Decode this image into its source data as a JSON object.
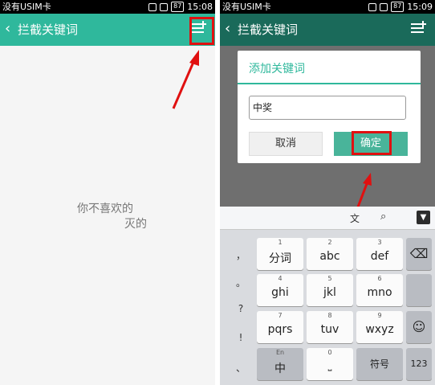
{
  "screen1": {
    "status": {
      "carrier": "没有USIM卡",
      "time": "15:08",
      "battery": "87"
    },
    "title": "拦截关键词",
    "add_icon": "add-keyword-icon",
    "empty_line1": "你不喜欢的",
    "empty_line2": "灭的"
  },
  "screen2": {
    "status": {
      "carrier": "没有USIM卡",
      "time": "15:09",
      "battery": "87"
    },
    "title": "拦截关键词",
    "dialog": {
      "title": "添加关键词",
      "input_value": "中奖",
      "cancel": "取消",
      "confirm": "确定"
    },
    "keyboard": {
      "cand_lang": "文",
      "rows": [
        [
          {
            "num": "1",
            "label": "分词"
          },
          {
            "num": "2",
            "label": "abc"
          },
          {
            "num": "3",
            "label": "def"
          }
        ],
        [
          {
            "num": "4",
            "label": "ghi"
          },
          {
            "num": "5",
            "label": "jkl"
          },
          {
            "num": "6",
            "label": "mno"
          }
        ],
        [
          {
            "num": "7",
            "label": "pqrs"
          },
          {
            "num": "8",
            "label": "tuv"
          },
          {
            "num": "9",
            "label": "wxyz"
          }
        ]
      ],
      "bottom": {
        "left_num": "En",
        "left": "中",
        "space_num": "0",
        "fuhao": "符号",
        "num_key": "123"
      },
      "side_symbols": [
        "，",
        "。",
        "?",
        "!",
        "、"
      ]
    }
  },
  "colors": {
    "teal": "#2fb89c",
    "annot": "#e01010"
  }
}
